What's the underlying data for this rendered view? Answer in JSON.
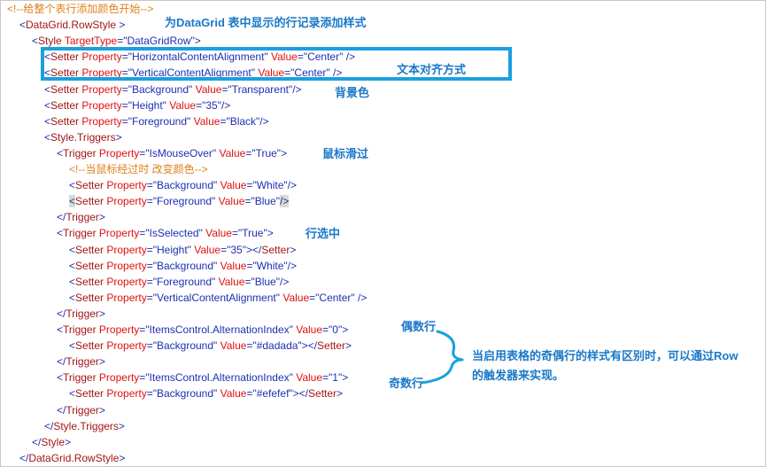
{
  "lines": [
    {
      "indent": 0,
      "parts": [
        {
          "cls": "comment",
          "t": "<!--给整个表行添加颜色开始-->"
        }
      ]
    },
    {
      "indent": 1,
      "parts": [
        {
          "cls": "tag",
          "t": "<"
        },
        {
          "cls": "elem",
          "t": "DataGrid.RowStyle"
        },
        {
          "cls": "tag",
          "t": " >"
        }
      ]
    },
    {
      "indent": 2,
      "parts": [
        {
          "cls": "tag",
          "t": "<"
        },
        {
          "cls": "elem",
          "t": "Style"
        },
        {
          "cls": "attr",
          "t": " TargetType"
        },
        {
          "cls": "tag",
          "t": "=\"DataGridRow\">"
        }
      ]
    },
    {
      "indent": 3,
      "parts": [
        {
          "cls": "tag",
          "t": "<"
        },
        {
          "cls": "elem",
          "t": "Setter"
        },
        {
          "cls": "attr",
          "t": " Property"
        },
        {
          "cls": "tag",
          "t": "=\"HorizontalContentAlignment\""
        },
        {
          "cls": "attr",
          "t": " Value"
        },
        {
          "cls": "tag",
          "t": "=\"Center\" />"
        }
      ]
    },
    {
      "indent": 3,
      "parts": [
        {
          "cls": "tag",
          "t": "<"
        },
        {
          "cls": "elem",
          "t": "Setter"
        },
        {
          "cls": "attr",
          "t": " Property"
        },
        {
          "cls": "tag",
          "t": "=\"VerticalContentAlignment\""
        },
        {
          "cls": "attr",
          "t": " Value"
        },
        {
          "cls": "tag",
          "t": "=\"Center\" />"
        }
      ]
    },
    {
      "indent": 3,
      "parts": [
        {
          "cls": "tag",
          "t": "<"
        },
        {
          "cls": "elem",
          "t": "Setter"
        },
        {
          "cls": "attr",
          "t": " Property"
        },
        {
          "cls": "tag",
          "t": "=\"Background\""
        },
        {
          "cls": "attr",
          "t": " Value"
        },
        {
          "cls": "tag",
          "t": "=\"Transparent\"/>"
        }
      ]
    },
    {
      "indent": 3,
      "parts": [
        {
          "cls": "tag",
          "t": "<"
        },
        {
          "cls": "elem",
          "t": "Setter"
        },
        {
          "cls": "attr",
          "t": " Property"
        },
        {
          "cls": "tag",
          "t": "=\"Height\""
        },
        {
          "cls": "attr",
          "t": " Value"
        },
        {
          "cls": "tag",
          "t": "=\"35\"/>"
        }
      ]
    },
    {
      "indent": 3,
      "parts": [
        {
          "cls": "tag",
          "t": "<"
        },
        {
          "cls": "elem",
          "t": "Setter"
        },
        {
          "cls": "attr",
          "t": " Property"
        },
        {
          "cls": "tag",
          "t": "=\"Foreground\""
        },
        {
          "cls": "attr",
          "t": " Value"
        },
        {
          "cls": "tag",
          "t": "=\"Black\"/>"
        }
      ]
    },
    {
      "indent": 3,
      "parts": [
        {
          "cls": "tag",
          "t": "<"
        },
        {
          "cls": "elem",
          "t": "Style.Triggers"
        },
        {
          "cls": "tag",
          "t": ">"
        }
      ]
    },
    {
      "indent": 4,
      "parts": [
        {
          "cls": "tag",
          "t": "<"
        },
        {
          "cls": "elem",
          "t": "Trigger"
        },
        {
          "cls": "attr",
          "t": " Property"
        },
        {
          "cls": "tag",
          "t": "=\"IsMouseOver\""
        },
        {
          "cls": "attr",
          "t": " Value"
        },
        {
          "cls": "tag",
          "t": "=\"True\">"
        }
      ]
    },
    {
      "indent": 5,
      "parts": [
        {
          "cls": "comment",
          "t": "<!--当鼠标经过时 改变颜色-->"
        }
      ]
    },
    {
      "indent": 5,
      "parts": [
        {
          "cls": "tag",
          "t": "<"
        },
        {
          "cls": "elem",
          "t": "Setter"
        },
        {
          "cls": "attr",
          "t": " Property"
        },
        {
          "cls": "tag",
          "t": "=\"Background\""
        },
        {
          "cls": "attr",
          "t": " Value"
        },
        {
          "cls": "tag",
          "t": "=\"White\"/>"
        }
      ]
    },
    {
      "indent": 5,
      "parts": [
        {
          "cls": "tag hl",
          "t": "<"
        },
        {
          "cls": "elem",
          "t": "Setter"
        },
        {
          "cls": "attr",
          "t": " Property"
        },
        {
          "cls": "tag",
          "t": "=\"Foreground\""
        },
        {
          "cls": "attr",
          "t": " Value"
        },
        {
          "cls": "tag",
          "t": "=\"Blue\""
        },
        {
          "cls": "tag hl",
          "t": "/>"
        }
      ]
    },
    {
      "indent": 4,
      "parts": [
        {
          "cls": "tag",
          "t": "</"
        },
        {
          "cls": "elem",
          "t": "Trigger"
        },
        {
          "cls": "tag",
          "t": ">"
        }
      ]
    },
    {
      "indent": 4,
      "parts": [
        {
          "cls": "tag",
          "t": "<"
        },
        {
          "cls": "elem",
          "t": "Trigger"
        },
        {
          "cls": "attr",
          "t": " Property"
        },
        {
          "cls": "tag",
          "t": "=\"IsSelected\""
        },
        {
          "cls": "attr",
          "t": " Value"
        },
        {
          "cls": "tag",
          "t": "=\"True\">"
        }
      ]
    },
    {
      "indent": 5,
      "parts": [
        {
          "cls": "tag",
          "t": "<"
        },
        {
          "cls": "elem",
          "t": "Setter"
        },
        {
          "cls": "attr",
          "t": " Property"
        },
        {
          "cls": "tag",
          "t": "=\"Height\""
        },
        {
          "cls": "attr",
          "t": " Value"
        },
        {
          "cls": "tag",
          "t": "=\"35\"></"
        },
        {
          "cls": "elem",
          "t": "Setter"
        },
        {
          "cls": "tag",
          "t": ">"
        }
      ]
    },
    {
      "indent": 5,
      "parts": [
        {
          "cls": "tag",
          "t": "<"
        },
        {
          "cls": "elem",
          "t": "Setter"
        },
        {
          "cls": "attr",
          "t": " Property"
        },
        {
          "cls": "tag",
          "t": "=\"Background\""
        },
        {
          "cls": "attr",
          "t": " Value"
        },
        {
          "cls": "tag",
          "t": "=\"White\"/>"
        }
      ]
    },
    {
      "indent": 5,
      "parts": [
        {
          "cls": "tag",
          "t": "<"
        },
        {
          "cls": "elem",
          "t": "Setter"
        },
        {
          "cls": "attr",
          "t": " Property"
        },
        {
          "cls": "tag",
          "t": "=\"Foreground\""
        },
        {
          "cls": "attr",
          "t": " Value"
        },
        {
          "cls": "tag",
          "t": "=\"Blue\"/>"
        }
      ]
    },
    {
      "indent": 5,
      "parts": [
        {
          "cls": "tag",
          "t": "<"
        },
        {
          "cls": "elem",
          "t": "Setter"
        },
        {
          "cls": "attr",
          "t": " Property"
        },
        {
          "cls": "tag",
          "t": "=\"VerticalContentAlignment\""
        },
        {
          "cls": "attr",
          "t": " Value"
        },
        {
          "cls": "tag",
          "t": "=\"Center\" />"
        }
      ]
    },
    {
      "indent": 4,
      "parts": [
        {
          "cls": "tag",
          "t": "</"
        },
        {
          "cls": "elem",
          "t": "Trigger"
        },
        {
          "cls": "tag",
          "t": ">"
        }
      ]
    },
    {
      "indent": 4,
      "parts": [
        {
          "cls": "tag",
          "t": "<"
        },
        {
          "cls": "elem",
          "t": "Trigger"
        },
        {
          "cls": "attr",
          "t": " Property"
        },
        {
          "cls": "tag",
          "t": "=\"ItemsControl.AlternationIndex\""
        },
        {
          "cls": "attr",
          "t": " Value"
        },
        {
          "cls": "tag",
          "t": "=\"0\">"
        }
      ]
    },
    {
      "indent": 5,
      "parts": [
        {
          "cls": "tag",
          "t": "<"
        },
        {
          "cls": "elem",
          "t": "Setter"
        },
        {
          "cls": "attr",
          "t": " Property"
        },
        {
          "cls": "tag",
          "t": "=\"Background\""
        },
        {
          "cls": "attr",
          "t": " Value"
        },
        {
          "cls": "tag",
          "t": "=\"#dadada\"></"
        },
        {
          "cls": "elem",
          "t": "Setter"
        },
        {
          "cls": "tag",
          "t": ">"
        }
      ]
    },
    {
      "indent": 4,
      "parts": [
        {
          "cls": "tag",
          "t": "</"
        },
        {
          "cls": "elem",
          "t": "Trigger"
        },
        {
          "cls": "tag",
          "t": ">"
        }
      ]
    },
    {
      "indent": 4,
      "parts": [
        {
          "cls": "tag",
          "t": "<"
        },
        {
          "cls": "elem",
          "t": "Trigger"
        },
        {
          "cls": "attr",
          "t": " Property"
        },
        {
          "cls": "tag",
          "t": "=\"ItemsControl.AlternationIndex\""
        },
        {
          "cls": "attr",
          "t": " Value"
        },
        {
          "cls": "tag",
          "t": "=\"1\">"
        }
      ]
    },
    {
      "indent": 5,
      "parts": [
        {
          "cls": "tag",
          "t": "<"
        },
        {
          "cls": "elem",
          "t": "Setter"
        },
        {
          "cls": "attr",
          "t": " Property"
        },
        {
          "cls": "tag",
          "t": "=\"Background\""
        },
        {
          "cls": "attr",
          "t": " Value"
        },
        {
          "cls": "tag",
          "t": "=\"#efefef\"></"
        },
        {
          "cls": "elem",
          "t": "Setter"
        },
        {
          "cls": "tag",
          "t": ">"
        }
      ]
    },
    {
      "indent": 4,
      "parts": [
        {
          "cls": "tag",
          "t": "</"
        },
        {
          "cls": "elem",
          "t": "Trigger"
        },
        {
          "cls": "tag",
          "t": ">"
        }
      ]
    },
    {
      "indent": 3,
      "parts": [
        {
          "cls": "tag",
          "t": "</"
        },
        {
          "cls": "elem",
          "t": "Style.Triggers"
        },
        {
          "cls": "tag",
          "t": ">"
        }
      ]
    },
    {
      "indent": 2,
      "parts": [
        {
          "cls": "tag",
          "t": "</"
        },
        {
          "cls": "elem",
          "t": "Style"
        },
        {
          "cls": "tag",
          "t": ">"
        }
      ]
    },
    {
      "indent": 1,
      "parts": [
        {
          "cls": "tag",
          "t": "</"
        },
        {
          "cls": "elem",
          "t": "DataGrid.RowStyle"
        },
        {
          "cls": "tag",
          "t": ">"
        }
      ]
    }
  ],
  "annotations": {
    "rowstyle_note": "为DataGrid 表中显示的行记录添加样式",
    "alignment_note": "文本对齐方式",
    "background_note": "背景色",
    "mouseover_note": "鼠标滑过",
    "selected_note": "行选中",
    "even_note": "偶数行",
    "odd_note": "奇数行",
    "summary_line1": "当启用表格的奇偶行的样式有区别时，可以通过Row",
    "summary_line2": "的触发器来实现。"
  },
  "colors": {
    "tag": "#1e2fb0",
    "element": "#a31515",
    "attribute": "#e01010",
    "comment": "#e0801a",
    "annotation": "#1a78c8",
    "highlight_box": "#1aa0e0"
  }
}
